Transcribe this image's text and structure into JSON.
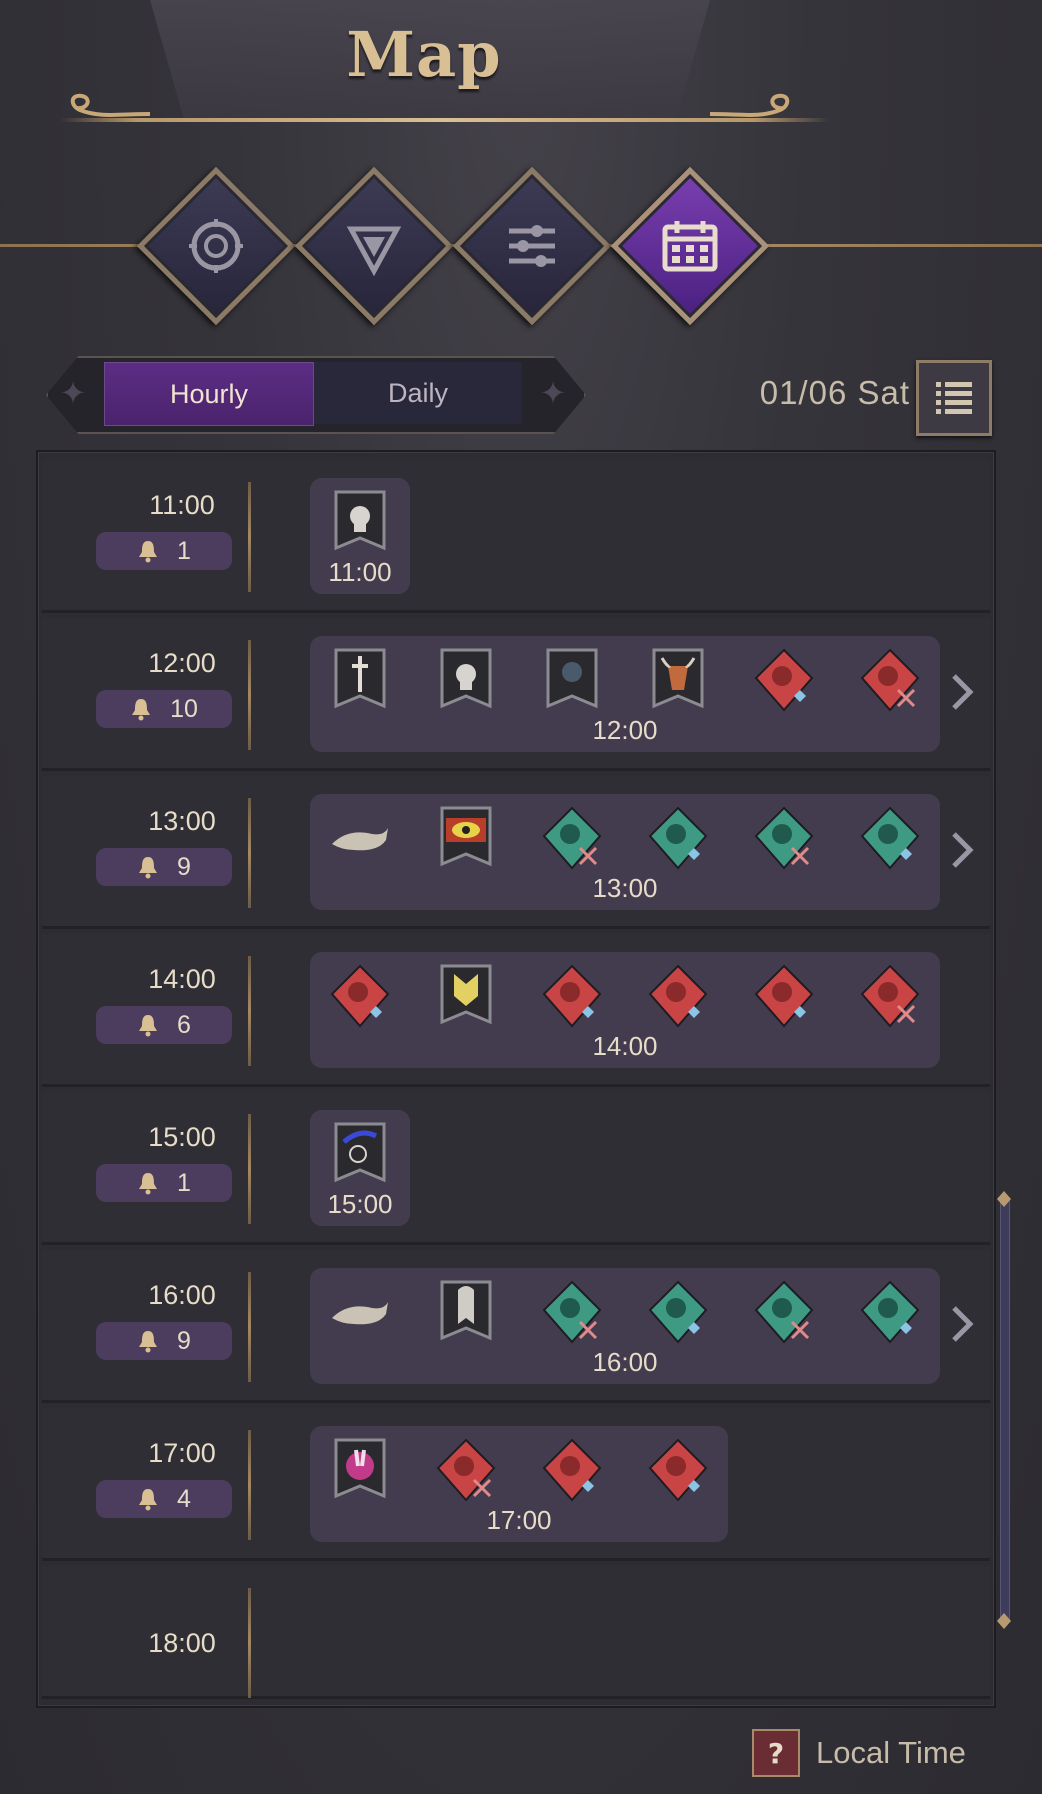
{
  "header": {
    "title": "Map"
  },
  "tabs": [
    {
      "icon": "compass-icon",
      "active": false
    },
    {
      "icon": "triangle-emblem-icon",
      "active": false
    },
    {
      "icon": "sliders-icon",
      "active": false
    },
    {
      "icon": "calendar-icon",
      "active": true
    }
  ],
  "view_toggle": {
    "hourly_label": "Hourly",
    "daily_label": "Daily",
    "selected": "Hourly"
  },
  "date": {
    "label": "01/06 Sat"
  },
  "schedule": [
    {
      "time": "11:00",
      "count": "1",
      "events": [
        "reaper-banner-icon"
      ],
      "more": false
    },
    {
      "time": "12:00",
      "count": "10",
      "events": [
        "sword-banner-icon",
        "reaper-banner-icon",
        "rose-banner-icon",
        "bull-banner-icon",
        "red-boar-icon",
        "red-beast-icon"
      ],
      "more": true
    },
    {
      "time": "13:00",
      "count": "9",
      "events": [
        "whale-icon",
        "eye-banner-icon",
        "green-skeleton-icon",
        "green-eye-icon",
        "green-creature-icon",
        "green-crystal-icon"
      ],
      "more": true
    },
    {
      "time": "14:00",
      "count": "6",
      "events": [
        "red-hood-icon",
        "fox-mask-banner-icon",
        "red-boar-icon",
        "red-elephant-icon",
        "red-boar-icon",
        "red-beast-icon"
      ],
      "more": false
    },
    {
      "time": "15:00",
      "count": "1",
      "events": [
        "moon-banner-icon"
      ],
      "more": false
    },
    {
      "time": "16:00",
      "count": "9",
      "events": [
        "whale-icon",
        "ghost-banner-icon",
        "green-skeleton-icon",
        "green-eye-icon",
        "green-creature-icon",
        "green-crystal-icon"
      ],
      "more": true
    },
    {
      "time": "17:00",
      "count": "4",
      "events": [
        "rabbit-banner-icon",
        "red-knight-icon",
        "red-tower-icon",
        "red-elephant-icon"
      ],
      "more": false
    },
    {
      "time": "18:00",
      "count": "",
      "events": [],
      "more": false
    }
  ],
  "footer": {
    "help_label": "?",
    "local_time_label": "Local Time"
  },
  "colors": {
    "accent": "#5c2d85",
    "gold": "#d9bf94",
    "red_event": "#c94545",
    "green_event": "#3f9a84"
  }
}
